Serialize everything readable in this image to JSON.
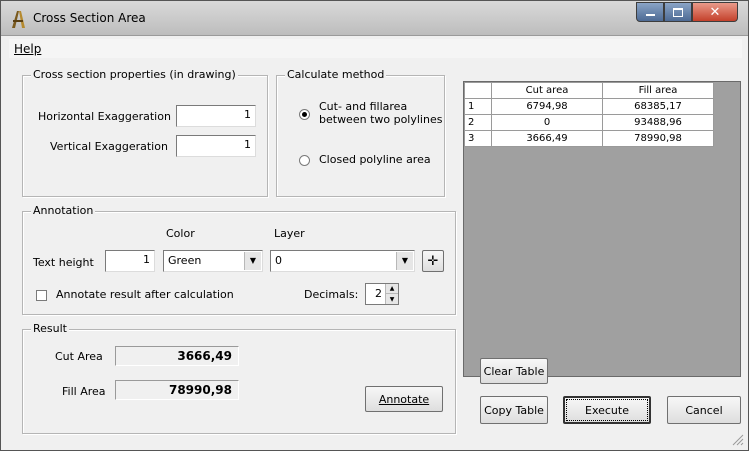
{
  "window": {
    "title": "Cross Section Area"
  },
  "menu": {
    "help": "Help"
  },
  "props": {
    "legend": "Cross section properties (in drawing)",
    "h_exag_label": "Horizontal Exaggeration",
    "h_exag_value": "1",
    "v_exag_label": "Vertical Exaggeration",
    "v_exag_value": "1"
  },
  "method": {
    "legend": "Calculate method",
    "option1_line1": "Cut- and fillarea",
    "option1_line2": "between two polylines",
    "option2": "Closed polyline area",
    "selected": 1
  },
  "annotation": {
    "legend": "Annotation",
    "color_label": "Color",
    "layer_label": "Layer",
    "text_height_label": "Text height",
    "text_height_value": "1",
    "color_value": "Green",
    "layer_value": "0",
    "annotate_after_label": "Annotate result after calculation",
    "annotate_after_checked": false,
    "decimals_label": "Decimals:",
    "decimals_value": "2"
  },
  "result": {
    "legend": "Result",
    "cut_label": "Cut Area",
    "cut_value": "3666,49",
    "fill_label": "Fill Area",
    "fill_value": "78990,98",
    "annotate_button": "Annotate"
  },
  "table": {
    "headers": [
      "",
      "Cut area",
      "Fill area"
    ],
    "rows": [
      [
        "1",
        "6794,98",
        "68385,17"
      ],
      [
        "2",
        "0",
        "93488,96"
      ],
      [
        "3",
        "3666,49",
        "78990,98"
      ]
    ]
  },
  "buttons": {
    "clear_table": "Clear Table",
    "copy_table": "Copy Table",
    "execute": "Execute",
    "cancel": "Cancel"
  },
  "colors": {
    "close_button": "#c4412b",
    "minmax_button": "#4d6a94",
    "grid_background": "#a0a0a0"
  }
}
